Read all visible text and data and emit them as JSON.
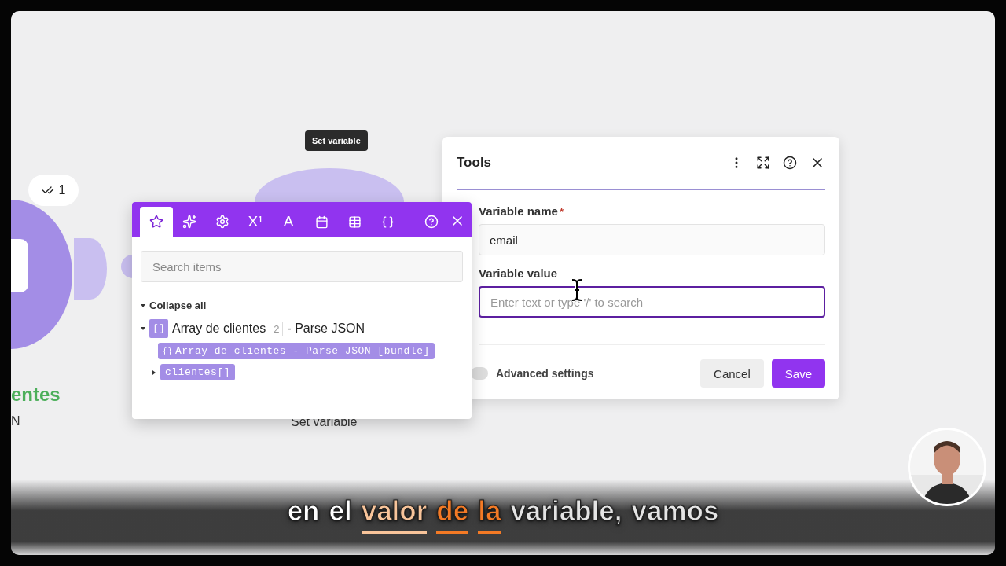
{
  "canvas": {
    "tooltip": "Set variable",
    "nodes": [
      {
        "kind": "source",
        "title": "entes",
        "subtitle": "N",
        "badge": "1"
      },
      {
        "kind": "target",
        "subtitle": "Set variable"
      }
    ]
  },
  "mapping_panel": {
    "tabs": [
      {
        "kind": "star",
        "selected": true
      },
      {
        "kind": "sparkles",
        "selected": false
      },
      {
        "kind": "gear",
        "selected": false
      },
      {
        "kind": "glyph",
        "label": "X¹",
        "selected": false
      },
      {
        "kind": "glyph",
        "label": "A",
        "selected": false
      },
      {
        "kind": "calendar",
        "selected": false
      },
      {
        "kind": "table",
        "selected": false
      },
      {
        "kind": "braces",
        "selected": false
      }
    ],
    "search": {
      "placeholder": "Search items"
    },
    "collapse_all": {
      "label": "Collapse all",
      "expanded": true
    },
    "tree": [
      {
        "label": "Array de clientes",
        "count": "2",
        "suffix": "- Parse JSON",
        "expanded": true,
        "children": [
          {
            "kind": "bundle",
            "label": "Array de clientes - Parse JSON [bundle]"
          },
          {
            "kind": "array",
            "label": "clientes[]",
            "expanded": false
          }
        ]
      }
    ]
  },
  "tools_dialog": {
    "title": "Tools",
    "fields": [
      {
        "label": "Variable name",
        "required_mark": "*",
        "value": "email",
        "focused": false
      },
      {
        "label": "Variable value",
        "placeholder": "Enter text or type '/' to search",
        "focused": true
      }
    ],
    "advanced": {
      "label": "Advanced settings",
      "on": false
    },
    "buttons": [
      {
        "label": "Cancel",
        "kind": "secondary"
      },
      {
        "label": "Save",
        "kind": "primary"
      }
    ]
  },
  "subtitle": [
    {
      "text": "en",
      "color": "#ffffff",
      "underlined": false
    },
    {
      "text": "el",
      "color": "#ffffff",
      "underlined": false
    },
    {
      "text": "valor",
      "color": "#f8c49a",
      "underlined": true
    },
    {
      "text": "de",
      "color": "#f47a25",
      "underlined": true
    },
    {
      "text": "la",
      "color": "#f47a25",
      "underlined": true
    },
    {
      "text": "variable,",
      "color": "#e4e4e4",
      "underlined": false
    },
    {
      "text": "vamos",
      "color": "#e4e4e4",
      "underlined": false
    }
  ]
}
